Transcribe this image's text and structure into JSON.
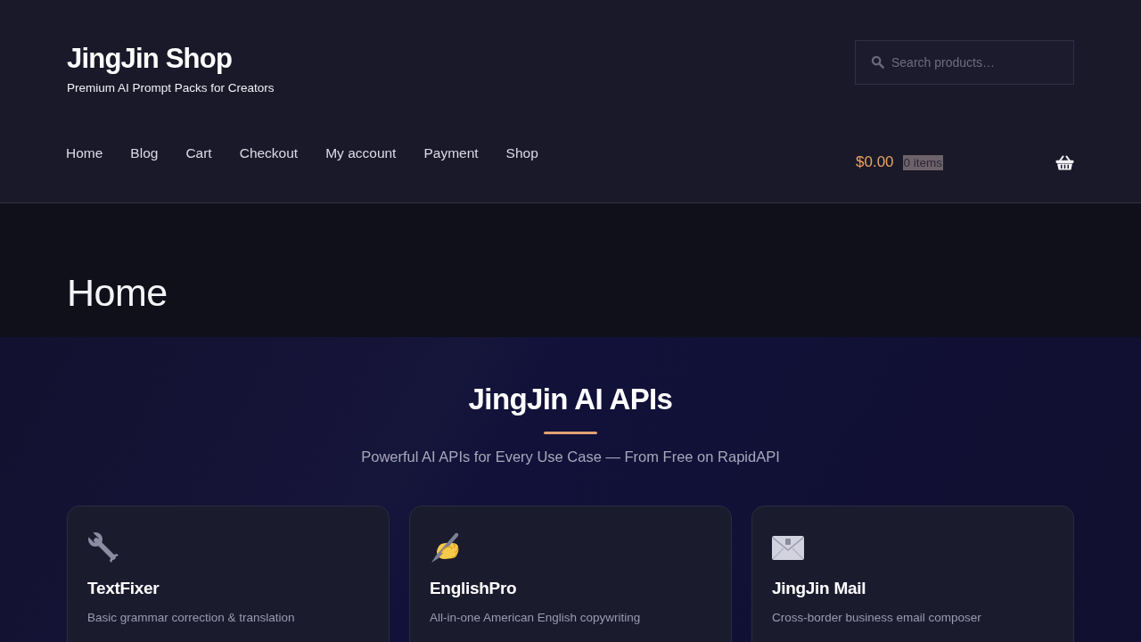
{
  "site": {
    "title": "JingJin Shop",
    "tagline": "Premium AI Prompt Packs for Creators"
  },
  "search": {
    "placeholder": "Search products…"
  },
  "nav": {
    "items": [
      "Home",
      "Blog",
      "Cart",
      "Checkout",
      "My account",
      "Payment",
      "Shop"
    ]
  },
  "cart": {
    "total": "$0.00",
    "count": "0 items"
  },
  "page_header": {
    "title": "Home"
  },
  "section": {
    "title": "JingJin AI APIs",
    "subtitle": "Powerful AI APIs for Every Use Case — From Free on RapidAPI",
    "cards": [
      {
        "title": "TextFixer",
        "description": "Basic grammar correction & translation"
      },
      {
        "title": "EnglishPro",
        "description": "All-in-one American English copywriting"
      },
      {
        "title": "JingJin Mail",
        "description": "Cross-border business email composer"
      }
    ]
  }
}
